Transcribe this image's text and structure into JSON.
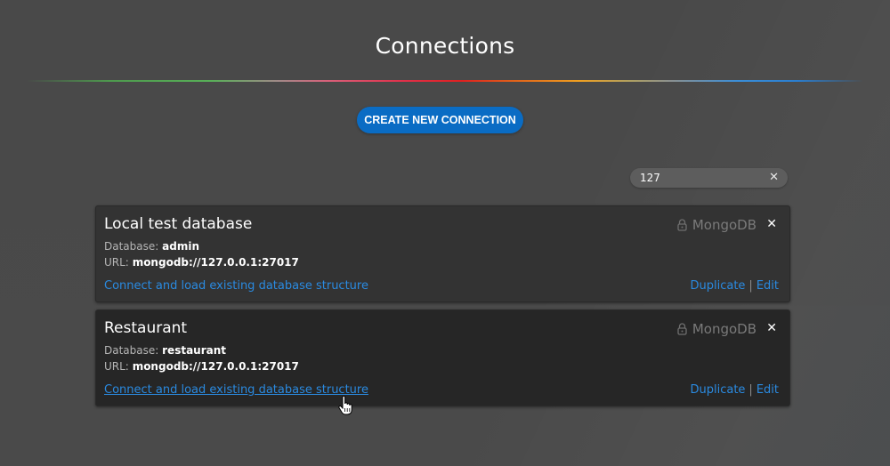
{
  "page": {
    "title": "Connections",
    "create_button_label": "CREATE NEW CONNECTION"
  },
  "search": {
    "value": "127",
    "clear_icon": "close-icon"
  },
  "colors": {
    "background": "#4a4a4a",
    "accent": "#0a6cc4",
    "link": "#2a8ae0",
    "card": "#333333",
    "card_hover": "#262626"
  },
  "connections": [
    {
      "name": "Local test database",
      "database_label": "Database:",
      "database": "admin",
      "url_label": "URL:",
      "url": "mongodb://127.0.0.1:27017",
      "type": "MongoDB",
      "type_icon": "lock-icon",
      "connect_label": "Connect and load existing database structure",
      "duplicate_label": "Duplicate",
      "separator": "|",
      "edit_label": "Edit"
    },
    {
      "name": "Restaurant",
      "database_label": "Database:",
      "database": "restaurant",
      "url_label": "URL:",
      "url": "mongodb://127.0.0.1:27017",
      "type": "MongoDB",
      "type_icon": "lock-icon",
      "connect_label": "Connect and load existing database structure",
      "duplicate_label": "Duplicate",
      "separator": "|",
      "edit_label": "Edit"
    }
  ]
}
